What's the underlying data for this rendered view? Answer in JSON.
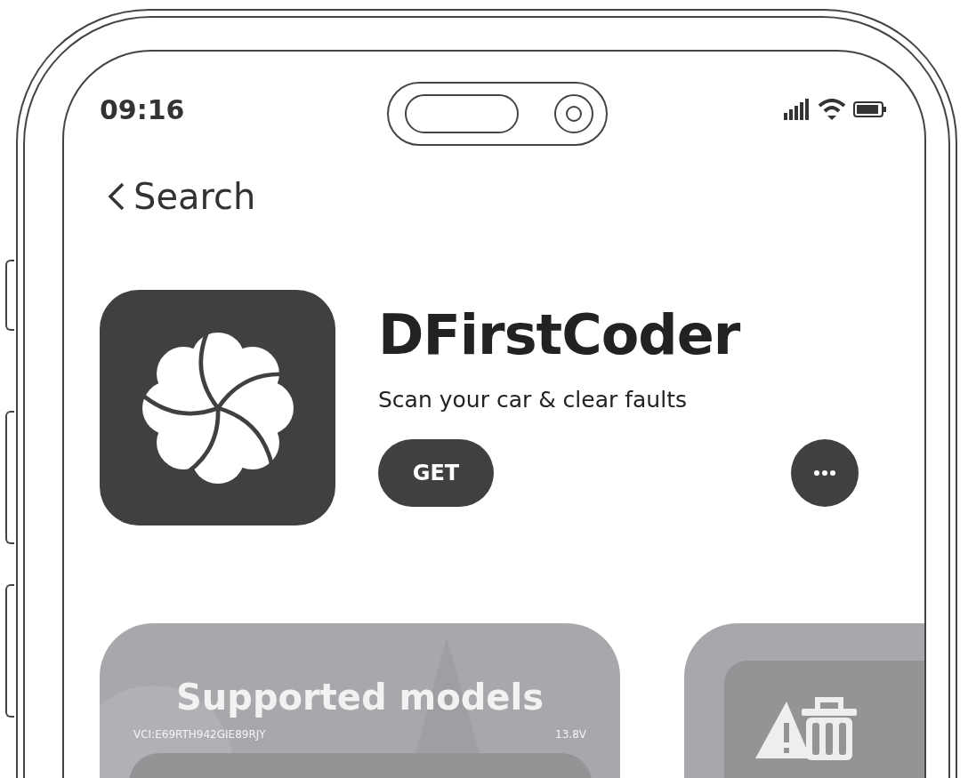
{
  "status_bar": {
    "time": "09:16"
  },
  "nav": {
    "back_label": "Search"
  },
  "app": {
    "name": "DFirstCoder",
    "subtitle": "Scan your car & clear faults",
    "get_button": "GET"
  },
  "cards": [
    {
      "kind": "promo",
      "title": "Supported models",
      "vci": "VCI:E69RTH942GIE89RJY",
      "voltage": "13.8V"
    },
    {
      "kind": "icon"
    }
  ]
}
